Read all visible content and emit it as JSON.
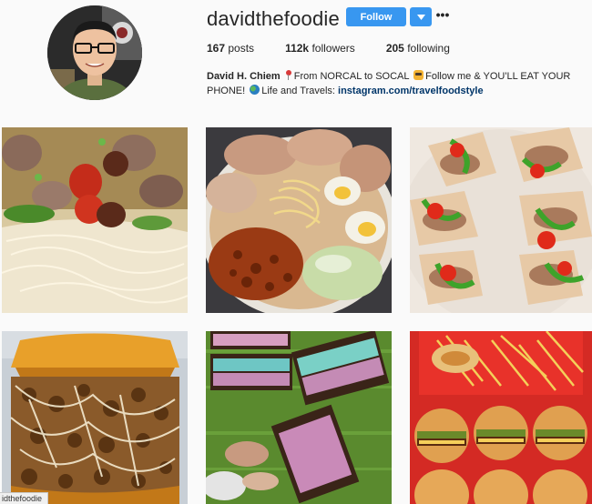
{
  "profile": {
    "username": "davidthefoodie",
    "follow_label": "Follow",
    "more_label": "•••",
    "stats": {
      "posts_count": "167",
      "posts_label": "posts",
      "followers_count": "112k",
      "followers_label": "followers",
      "following_count": "205",
      "following_label": "following"
    },
    "bio": {
      "name": "David H. Chiem",
      "text1": "From NORCAL to SOCAL",
      "text2": "Follow me & YOU'LL EAT YOUR PHONE!",
      "text3": "Life and Travels:",
      "link": "instagram.com/travelfoodstyle"
    }
  },
  "status_bar": {
    "text": "idthefoodie"
  },
  "colors": {
    "accent": "#3897f0",
    "link": "#003569",
    "background": "#fafafa"
  }
}
